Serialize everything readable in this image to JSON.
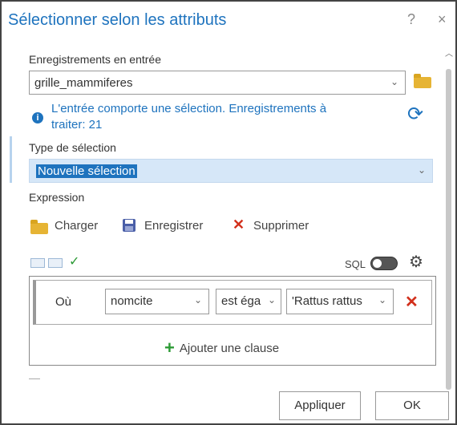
{
  "dialog": {
    "title": "Sélectionner selon les attributs",
    "help_label": "?",
    "close_label": "×"
  },
  "input": {
    "label": "Enregistrements en entrée",
    "value": "grille_mammiferes",
    "chevron": "⌄"
  },
  "info": {
    "icon": "i",
    "line1": "L'entrée comporte une sélection. Enregistrements à",
    "line2": "traiter: 21",
    "refresh_icon": "⟳"
  },
  "selection_type": {
    "label": "Type de sélection",
    "value": "Nouvelle sélection",
    "chevron": "⌄"
  },
  "expression": {
    "label": "Expression",
    "load_label": "Charger",
    "save_label": "Enregistrer",
    "delete_icon": "✕",
    "delete_label": "Supprimer",
    "check_icon": "✓",
    "sql_label": "SQL",
    "gear_icon": "⚙"
  },
  "clause": {
    "where_label": "Où",
    "field": "nomcite",
    "operator": "est éga",
    "value": "'Rattus rattus",
    "chevron": "⌄",
    "delete_icon": "✕",
    "add_icon": "+",
    "add_label": "Ajouter une clause"
  },
  "footer": {
    "apply_label": "Appliquer",
    "ok_label": "OK"
  },
  "colors": {
    "accent": "#1e73be",
    "selection_bg": "#d6e7f8",
    "delete_red": "#d2301c",
    "add_green": "#2c9a35",
    "folder": "#e6b434"
  }
}
